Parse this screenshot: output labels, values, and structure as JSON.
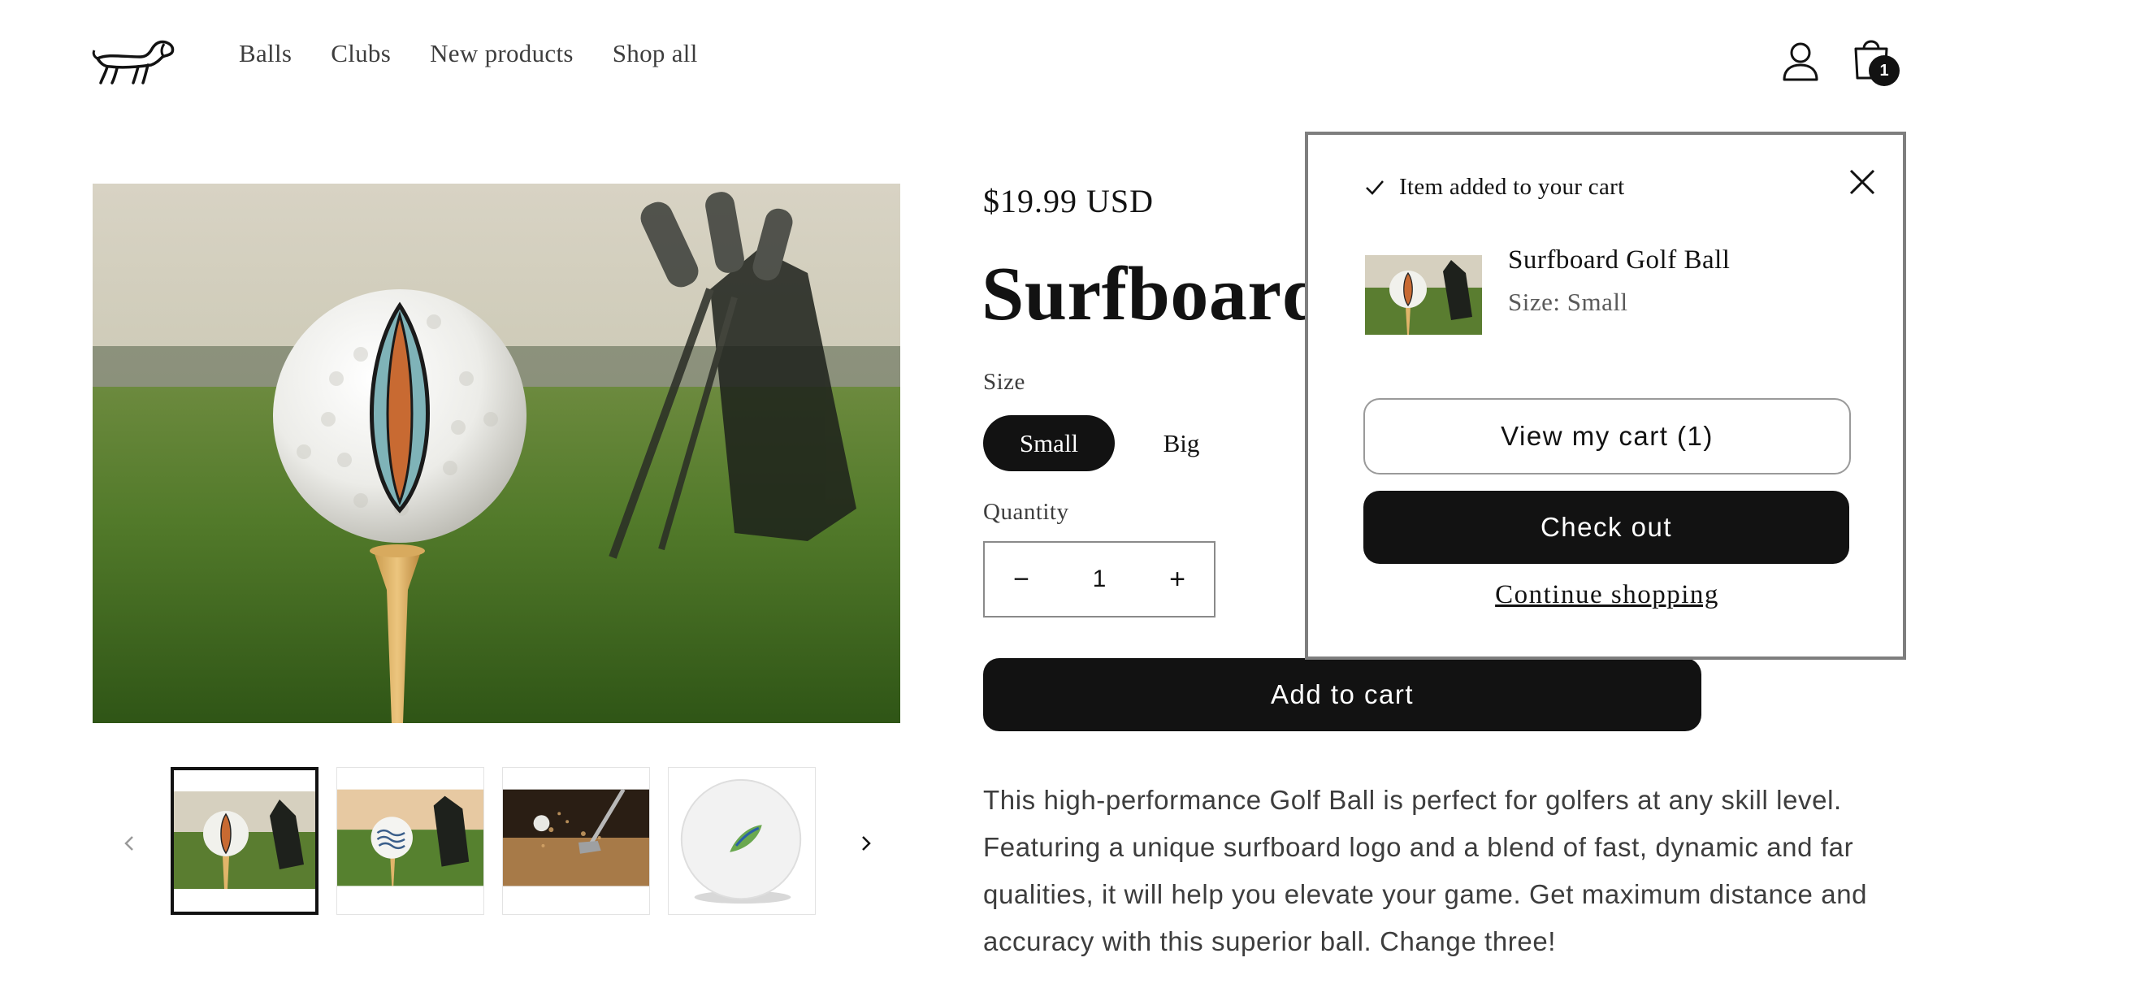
{
  "header": {
    "logo": "dachshund-logo",
    "nav": [
      "Balls",
      "Clubs",
      "New products",
      "Shop all"
    ],
    "account_icon": "user-icon",
    "cart_icon": "shopping-bag-icon",
    "cart_count": "1"
  },
  "gallery": {
    "prev_icon": "chevron-left-icon",
    "next_icon": "chevron-right-icon",
    "thumbnails": [
      "surfboard-ball-on-tee",
      "wave-ball-on-tee",
      "bunker-shot",
      "leaf-logo-ball"
    ],
    "active_index": 0
  },
  "product": {
    "price": "$19.99 USD",
    "title": "Surfboard Golf Ball",
    "size_label": "Size",
    "size_options": [
      "Small",
      "Big"
    ],
    "selected_size": "Small",
    "quantity_label": "Quantity",
    "quantity": "1",
    "add_to_cart": "Add to cart",
    "description": "This high-performance Golf Ball is perfect for golfers at any skill level. Featuring a unique surfboard logo and a blend of fast, dynamic and far qualities, it will help you elevate your game. Get maximum distance and accuracy with this superior ball. Change three!"
  },
  "cart_notification": {
    "heading": "Item added to your cart",
    "item_name": "Surfboard Golf Ball",
    "item_variant": "Size: Small",
    "view_cart": "View my cart (1)",
    "checkout": "Check out",
    "continue": "Continue shopping"
  },
  "colors": {
    "primary": "#121212",
    "text_muted": "#3d3d3d",
    "border": "#7e7e7e",
    "background": "#ffffff"
  }
}
